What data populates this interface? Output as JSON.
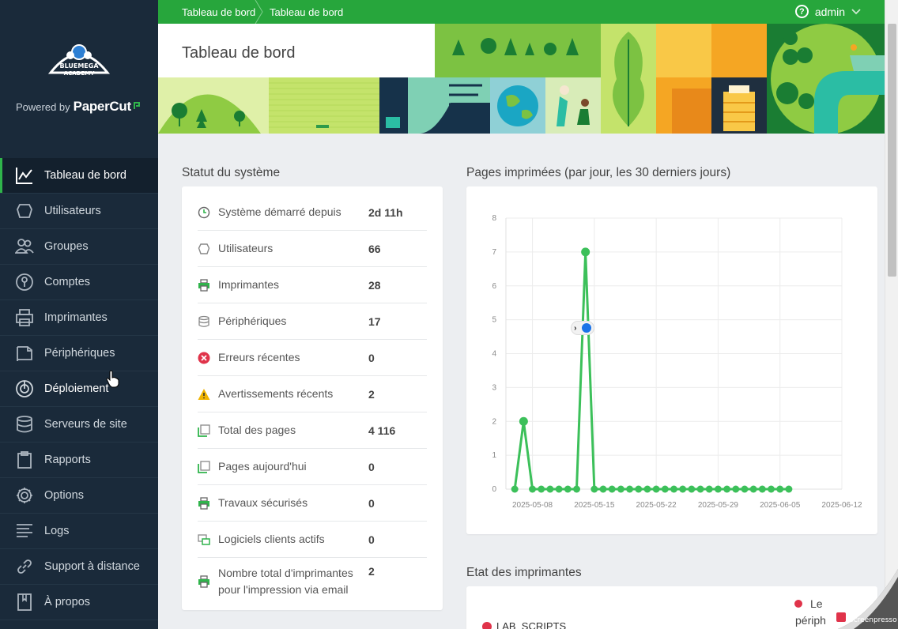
{
  "app": {
    "logo_text_top": "BLUEMEGA",
    "logo_text_bottom": "ACADEMY",
    "powered_by": "Powered by",
    "brand": "PaperCut"
  },
  "sidebar": {
    "items": [
      {
        "label": "Tableau de bord",
        "icon": "chart-line-icon",
        "active": true
      },
      {
        "label": "Utilisateurs",
        "icon": "user-icon"
      },
      {
        "label": "Groupes",
        "icon": "group-icon"
      },
      {
        "label": "Comptes",
        "icon": "account-icon"
      },
      {
        "label": "Imprimantes",
        "icon": "printer-icon"
      },
      {
        "label": "Périphériques",
        "icon": "device-icon"
      },
      {
        "label": "Déploiement",
        "icon": "deployment-icon"
      },
      {
        "label": "Serveurs de site",
        "icon": "database-icon"
      },
      {
        "label": "Rapports",
        "icon": "clipboard-icon"
      },
      {
        "label": "Options",
        "icon": "gear-icon"
      },
      {
        "label": "Logs",
        "icon": "logs-icon"
      },
      {
        "label": "Support à distance",
        "icon": "link-icon"
      },
      {
        "label": "À propos",
        "icon": "book-icon"
      }
    ]
  },
  "topbar": {
    "breadcrumb1": "Tableau de bord",
    "breadcrumb2": "Tableau de bord",
    "user": "admin"
  },
  "banner": {
    "title": "Tableau de bord"
  },
  "status": {
    "title": "Statut du système",
    "rows": [
      {
        "label": "Système démarré depuis",
        "value": "2d 11h",
        "icon": "clock-icon"
      },
      {
        "label": "Utilisateurs",
        "value": "66",
        "icon": "user-icon"
      },
      {
        "label": "Imprimantes",
        "value": "28",
        "icon": "printer-icon"
      },
      {
        "label": "Périphériques",
        "value": "17",
        "icon": "device-icon"
      },
      {
        "label": "Erreurs récentes",
        "value": "0",
        "icon": "error-icon"
      },
      {
        "label": "Avertissements récents",
        "value": "2",
        "icon": "warning-icon"
      },
      {
        "label": "Total des pages",
        "value": "4 116",
        "icon": "pages-icon"
      },
      {
        "label": "Pages aujourd'hui",
        "value": "0",
        "icon": "pages-icon"
      },
      {
        "label": "Travaux sécurisés",
        "value": "0",
        "icon": "printer-icon"
      },
      {
        "label": "Logiciels clients actifs",
        "value": "0",
        "icon": "client-icon"
      },
      {
        "label": "Nombre total d'imprimantes pour l'impression via email",
        "value": "2",
        "icon": "printer-icon"
      }
    ]
  },
  "chart_title": "Pages imprimées (par jour, les 30 derniers jours)",
  "chart_data": {
    "type": "line",
    "x": [
      "2025-05-06",
      "2025-05-07",
      "2025-05-08",
      "2025-05-09",
      "2025-05-10",
      "2025-05-11",
      "2025-05-12",
      "2025-05-13",
      "2025-05-14",
      "2025-05-15",
      "2025-05-16",
      "2025-05-17",
      "2025-05-18",
      "2025-05-19",
      "2025-05-20",
      "2025-05-21",
      "2025-05-22",
      "2025-05-23",
      "2025-05-24",
      "2025-05-25",
      "2025-05-26",
      "2025-05-27",
      "2025-05-28",
      "2025-05-29",
      "2025-05-30",
      "2025-05-31",
      "2025-06-01",
      "2025-06-02",
      "2025-06-03",
      "2025-06-04",
      "2025-06-05",
      "2025-06-06"
    ],
    "series": [
      {
        "values": [
          0,
          2,
          0,
          0,
          0,
          0,
          0,
          0,
          7,
          0,
          0,
          0,
          0,
          0,
          0,
          0,
          0,
          0,
          0,
          0,
          0,
          0,
          0,
          0,
          0,
          0,
          0,
          0,
          0,
          0,
          0,
          0
        ]
      }
    ],
    "xticks": [
      "2025-05-08",
      "2025-05-15",
      "2025-05-22",
      "2025-05-29",
      "2025-06-05",
      "2025-06-12"
    ],
    "yticks": [
      "0",
      "1",
      "2",
      "3",
      "4",
      "5",
      "6",
      "7",
      "8"
    ],
    "ylim": [
      0,
      8
    ],
    "xlim": [
      "2025-05-05",
      "2025-06-12"
    ],
    "grid": true,
    "color": "#3cc05a"
  },
  "printer_status": {
    "title": "Etat des imprimantes",
    "legend_line1": "Le",
    "legend_line2": "périph",
    "first_printer": "LAB_SCRIPTS"
  },
  "colors": {
    "sidebar": "#1a2a3a",
    "accent": "#27a63c",
    "error": "#e0334a",
    "warning": "#f0b400"
  }
}
